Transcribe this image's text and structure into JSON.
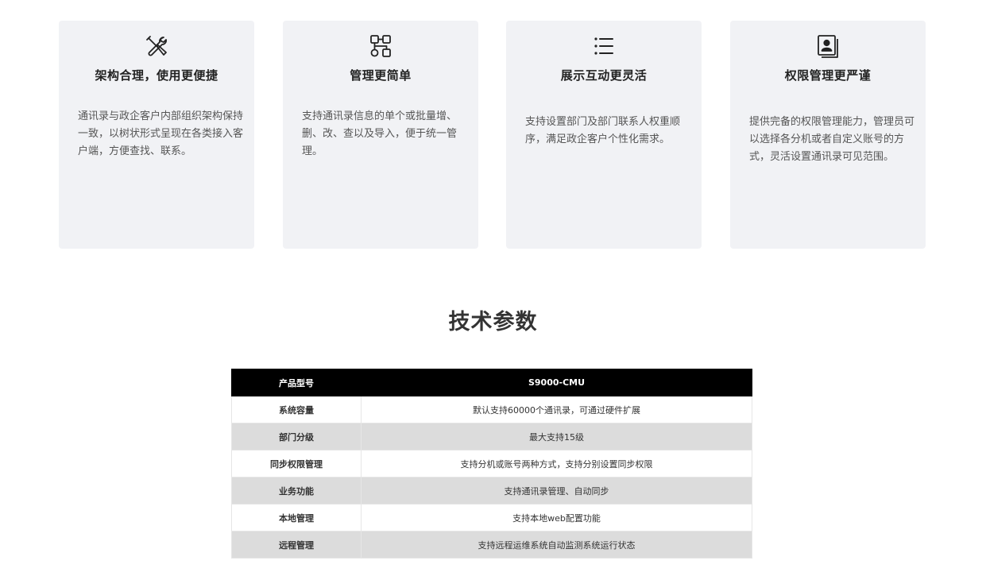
{
  "features": [
    {
      "icon": "tools-icon",
      "title": "架构合理，使用更便捷",
      "desc": "通讯录与政企客户内部组织架构保持一致，以树状形式呈现在各类接入客户端，方便查找、联系。"
    },
    {
      "icon": "org-chart-icon",
      "title": "管理更简单",
      "desc": "支持通讯录信息的单个或批量增、删、改、查以及导入，便于统一管理。"
    },
    {
      "icon": "list-icon",
      "title": "展示互动更灵活",
      "desc": "支持设置部门及部门联系人权重顺序，满足政企客户个性化需求。"
    },
    {
      "icon": "contact-card-icon",
      "title": "权限管理更严谨",
      "desc": "提供完备的权限管理能力，管理员可以选择各分机或者自定义账号的方式，灵活设置通讯录可见范围。"
    }
  ],
  "specs": {
    "title": "技术参数",
    "header": {
      "key": "产品型号",
      "value": "S9000-CMU"
    },
    "rows": [
      {
        "key": "系统容量",
        "value": "默认支持60000个通讯录，可通过硬件扩展"
      },
      {
        "key": "部门分级",
        "value": "最大支持15级"
      },
      {
        "key": "同步权限管理",
        "value": "支持分机或账号两种方式，支持分别设置同步权限"
      },
      {
        "key": "业务功能",
        "value": "支持通讯录管理、自动同步"
      },
      {
        "key": "本地管理",
        "value": "支持本地web配置功能"
      },
      {
        "key": "远程管理",
        "value": "支持远程运维系统自动监测系统运行状态"
      }
    ]
  }
}
